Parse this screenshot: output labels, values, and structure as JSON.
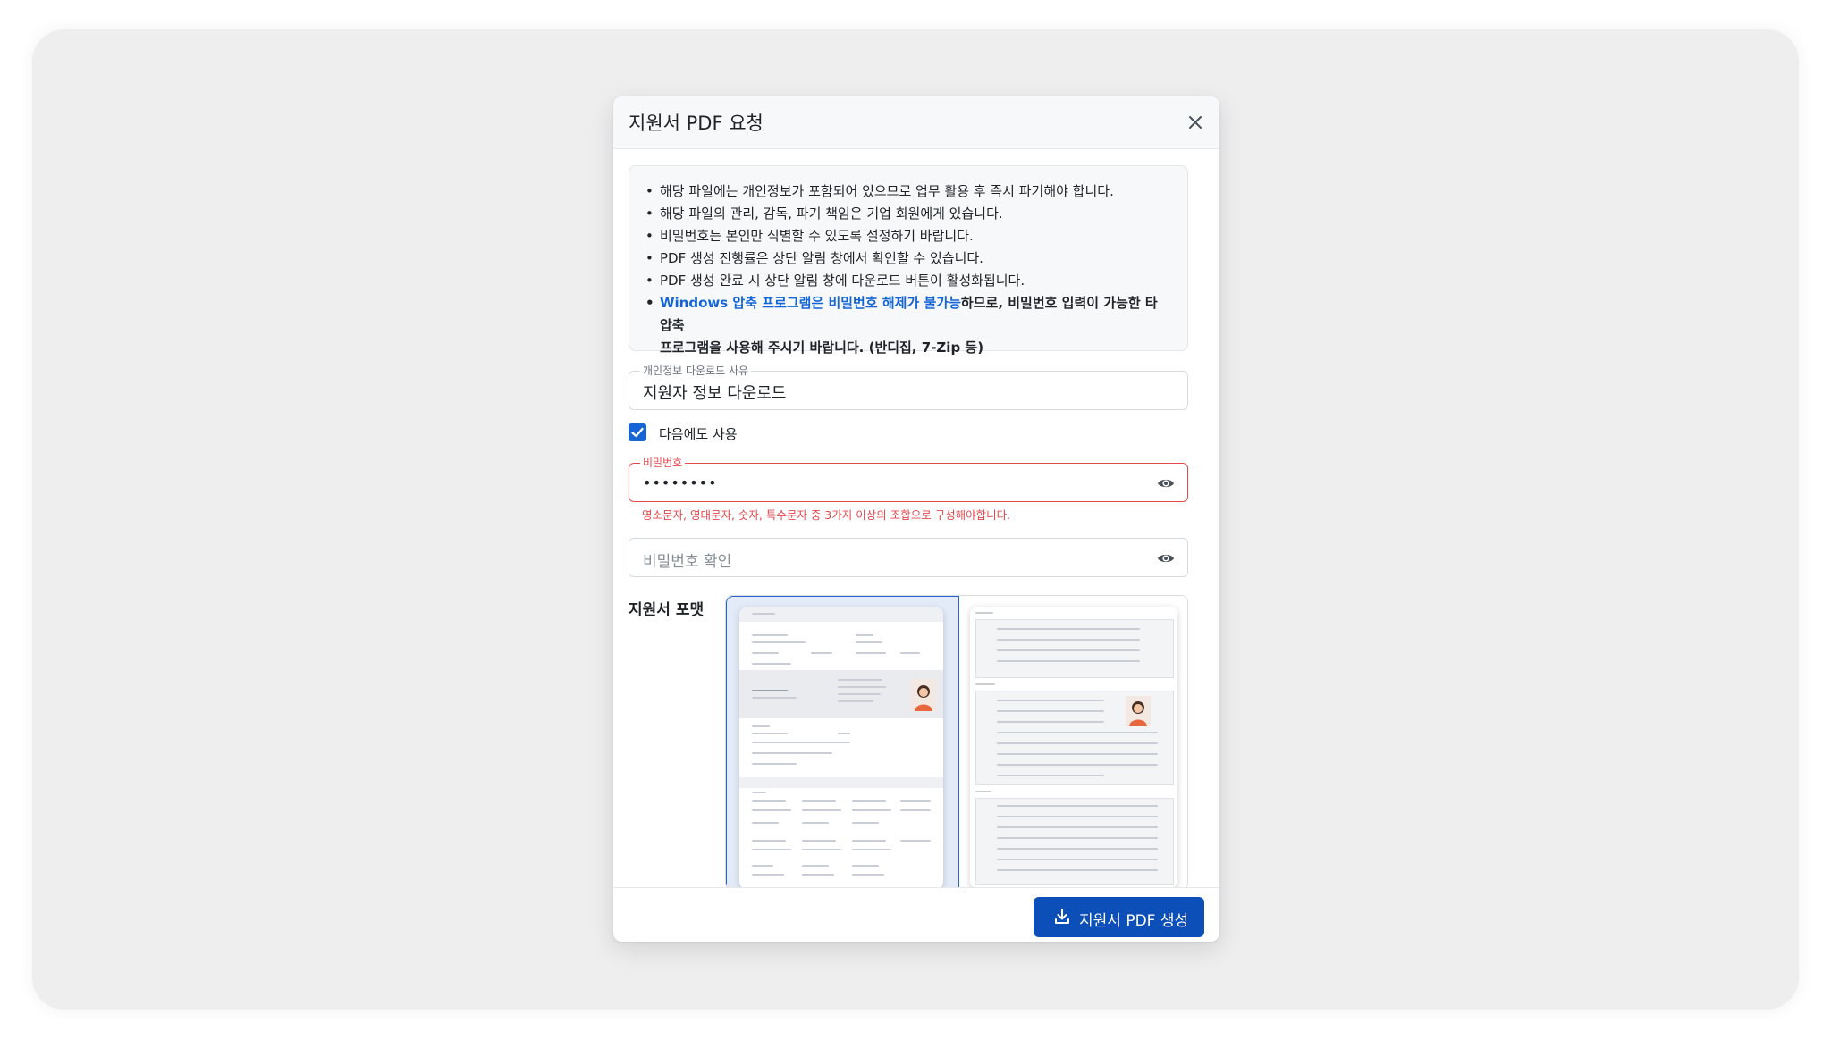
{
  "dialog": {
    "title": "지원서 PDF 요청",
    "close_icon": "close-icon"
  },
  "notice": {
    "items": [
      "해당 파일에는 개인정보가 포함되어 있으므로 업무 활용 후 즉시 파기해야 합니다.",
      "해당 파일의 관리, 감독, 파기 책임은 기업 회원에게 있습니다.",
      "비밀번호는 본인만 식별할 수 있도록 설정하기 바랍니다.",
      "PDF 생성 진행률은 상단 알림 창에서 확인할 수 있습니다.",
      "PDF 생성 완료 시 상단 알림 창에 다운로드 버튼이 활성화됩니다."
    ],
    "warning_link": "Windows 압축 프로그램은 비밀번호 해제가 불가능",
    "warning_line1_rest": "하므로, 비밀번호 입력이 가능한 타 압축",
    "warning_line2": "프로그램을 사용해 주시기 바랍니다. (반디집, 7-Zip 등)"
  },
  "reason_field": {
    "label": "개인정보 다운로드 사유",
    "value": "지원자 정보 다운로드"
  },
  "reuse_checkbox": {
    "label": "다음에도 사용",
    "checked": true
  },
  "password_field": {
    "label": "비밀번호",
    "value": "••••••••",
    "error": "영소문자, 영대문자, 숫자, 특수문자 중 3가지 이상의 조합으로 구성해야합니다."
  },
  "password_confirm_field": {
    "placeholder": "비밀번호 확인"
  },
  "format": {
    "label": "지원서 포맷",
    "selected_index": 0
  },
  "footer": {
    "generate_button": "지원서 PDF 생성"
  },
  "colors": {
    "primary": "#0d4fb8",
    "error": "#e5484d",
    "link": "#1465d6",
    "selected_bg": "#e3ebf8"
  }
}
